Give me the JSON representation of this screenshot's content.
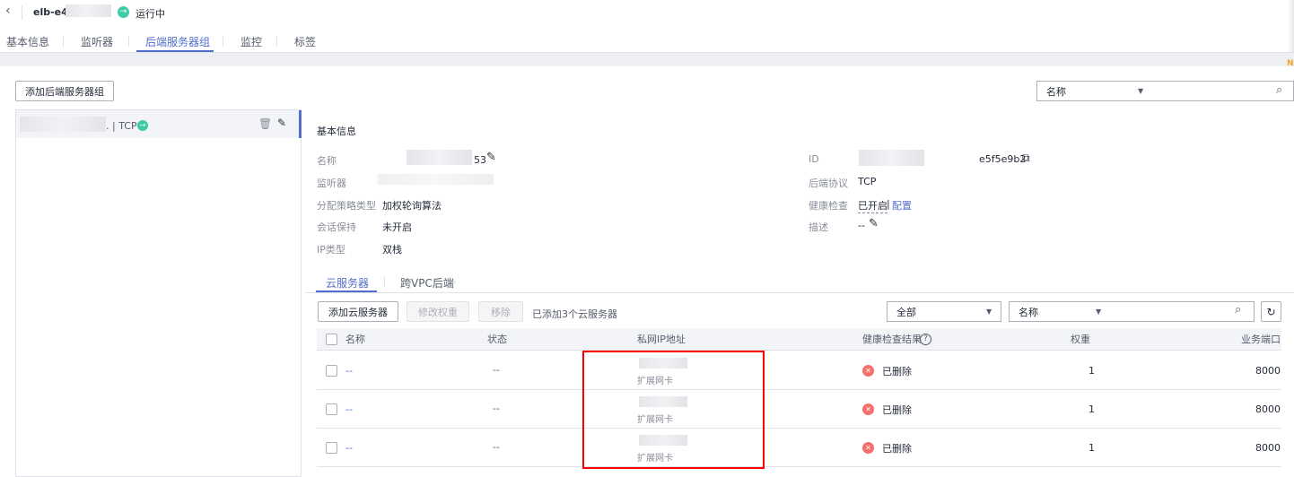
{
  "header": {
    "title": "elb-e4d6",
    "status": "运行中"
  },
  "tabs": [
    {
      "label": "基本信息"
    },
    {
      "label": "监听器"
    },
    {
      "label": "后端服务器组"
    },
    {
      "label": "监控"
    },
    {
      "label": "标签"
    }
  ],
  "toolbar": {
    "add_group": "添加后端服务器组",
    "search_field": "名称"
  },
  "group_list": [
    {
      "protocol": ". | TCP"
    }
  ],
  "basic": {
    "title": "基本信息",
    "name_label": "名称",
    "name_value": "53",
    "listener_label": "监听器",
    "algo_label": "分配策略类型",
    "algo_value": "加权轮询算法",
    "session_label": "会话保持",
    "session_value": "未开启",
    "iptype_label": "IP类型",
    "iptype_value": "双栈",
    "id_label": "ID",
    "id_value": "e5f5e9b2",
    "proto_label": "后端协议",
    "proto_value": "TCP",
    "health_label": "健康检查",
    "health_value": "已开启",
    "health_sep": "|",
    "health_link": "配置",
    "desc_label": "描述",
    "desc_value": "--"
  },
  "subtabs": [
    {
      "label": "云服务器"
    },
    {
      "label": "跨VPC后端"
    }
  ],
  "servers_toolbar": {
    "add": "添加云服务器",
    "modify_weight": "修改权重",
    "remove": "移除",
    "count_text": "已添加3个云服务器",
    "filter": "全部",
    "search_field": "名称"
  },
  "table": {
    "headers": {
      "name": "名称",
      "status": "状态",
      "ip": "私网IP地址",
      "health": "健康检查结果",
      "weight": "权重",
      "port": "业务端口"
    },
    "rows": [
      {
        "name": "--",
        "status": "--",
        "ip_type": "扩展网卡",
        "health": "已删除",
        "weight": "1",
        "port": "8000"
      },
      {
        "name": "--",
        "status": "--",
        "ip_type": "扩展网卡",
        "health": "已删除",
        "weight": "1",
        "port": "8000"
      },
      {
        "name": "--",
        "status": "--",
        "ip_type": "扩展网卡",
        "health": "已删除",
        "weight": "1",
        "port": "8000"
      }
    ]
  },
  "colors": {
    "accent": "#526ecc",
    "success": "#3dcca6",
    "error": "#f66f6a",
    "highlight": "#ff0000"
  }
}
